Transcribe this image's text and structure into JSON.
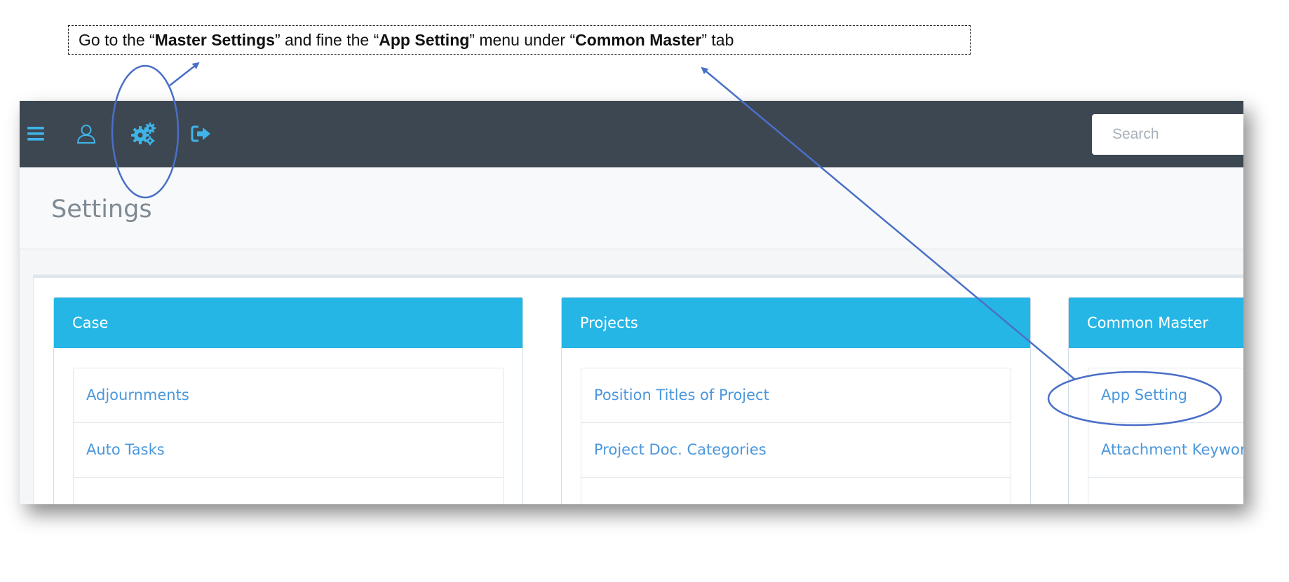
{
  "callout": {
    "t1": "Go to the “",
    "b1": "Master Settings",
    "t2": "” and fine the “",
    "b2": "App Setting",
    "t3": "” menu under “",
    "b3": "Common Master",
    "t4": "” tab"
  },
  "topbar": {
    "icons": [
      "menu-icon",
      "user-icon",
      "gears-icon",
      "logout-icon"
    ],
    "search_placeholder": "Search"
  },
  "page": {
    "title": "Settings"
  },
  "panels": [
    {
      "title": "Case",
      "items": [
        "Adjournments",
        "Auto Tasks"
      ]
    },
    {
      "title": "Projects",
      "items": [
        "Position Titles of Project",
        "Project Doc. Categories"
      ]
    },
    {
      "title": "Common Master",
      "items": [
        "App Setting",
        "Attachment Keyword"
      ]
    }
  ],
  "colors": {
    "topbar": "#3c4751",
    "accent": "#25b6e6",
    "link": "#4a97dc",
    "icon": "#3fb4e9",
    "annotation": "#4a6fc7"
  }
}
